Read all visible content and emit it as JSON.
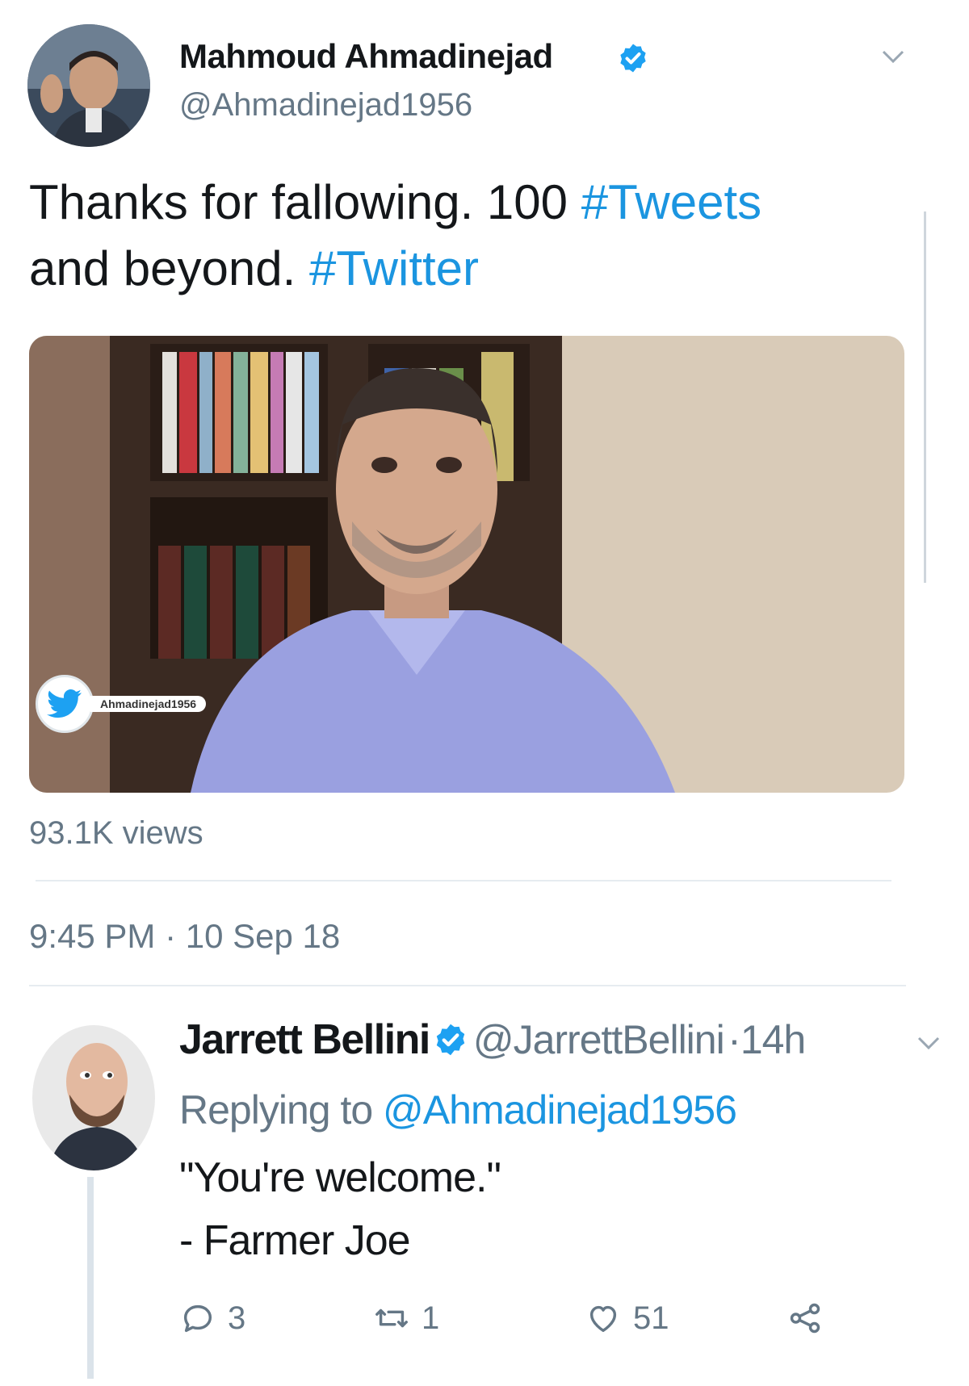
{
  "tweet": {
    "author_name": "Mahmoud Ahmadinejad",
    "author_handle": "@Ahmadinejad1956",
    "text_parts": [
      "Thanks for fallowing. 100 ",
      "#Tweets",
      " and beyond. ",
      "#Twitter"
    ],
    "media_watermark": "Ahmadinejad1956",
    "views": "93.1K views",
    "timestamp": "9:45 PM · 10 Sep 18"
  },
  "reply": {
    "author_name": "Jarrett Bellini",
    "author_handle": "@JarrettBellini",
    "separator": "·",
    "age": "14h",
    "replying_prefix": "Replying to ",
    "replying_handle": "@Ahmadinejad1956",
    "body_line1": "\"You're welcome.\"",
    "body_line2": "- Farmer Joe",
    "actions": {
      "reply_count": "3",
      "retweet_count": "1",
      "like_count": "51"
    }
  },
  "icons": {
    "verified": "verified-badge-icon",
    "caret": "chevron-down-icon",
    "reply": "reply-bubble-icon",
    "retweet": "retweet-icon",
    "like": "heart-icon",
    "share": "share-icon",
    "watermark": "twitter-bird-icon"
  },
  "colors": {
    "link": "#1b95e0",
    "muted": "#657786",
    "text": "#14171a",
    "verified": "#1da1f2"
  }
}
